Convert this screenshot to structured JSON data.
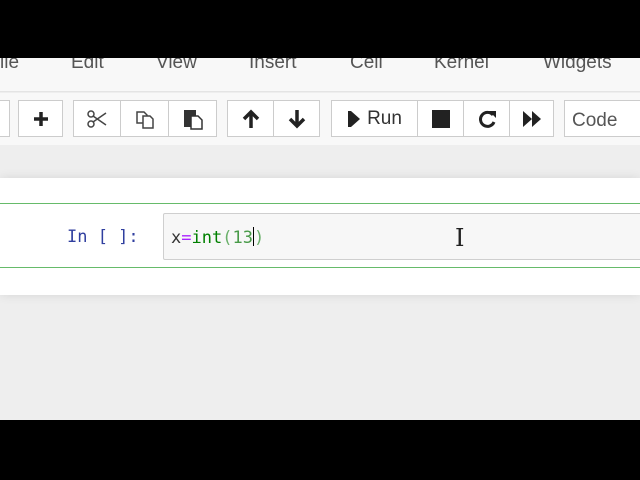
{
  "menubar": {
    "items": [
      "ile",
      "Edit",
      "View",
      "Insert",
      "Cell",
      "Kernel",
      "Widgets"
    ]
  },
  "toolbar": {
    "run_label": "Run",
    "cell_type": "Code",
    "icons": [
      "save-icon",
      "plus-icon",
      "scissors-icon",
      "copy-icon",
      "paste-icon",
      "arrow-up-icon",
      "arrow-down-icon",
      "step-forward-icon",
      "stop-icon",
      "restart-icon",
      "fast-forward-icon"
    ]
  },
  "cell": {
    "prompt": "In [ ]:",
    "code_var": "x",
    "code_op": "=",
    "code_func": "int",
    "code_open": "(",
    "code_num": "13",
    "code_close": ")"
  },
  "colors": {
    "cell_border": "#66bb6a",
    "prompt": "#303f9f"
  }
}
